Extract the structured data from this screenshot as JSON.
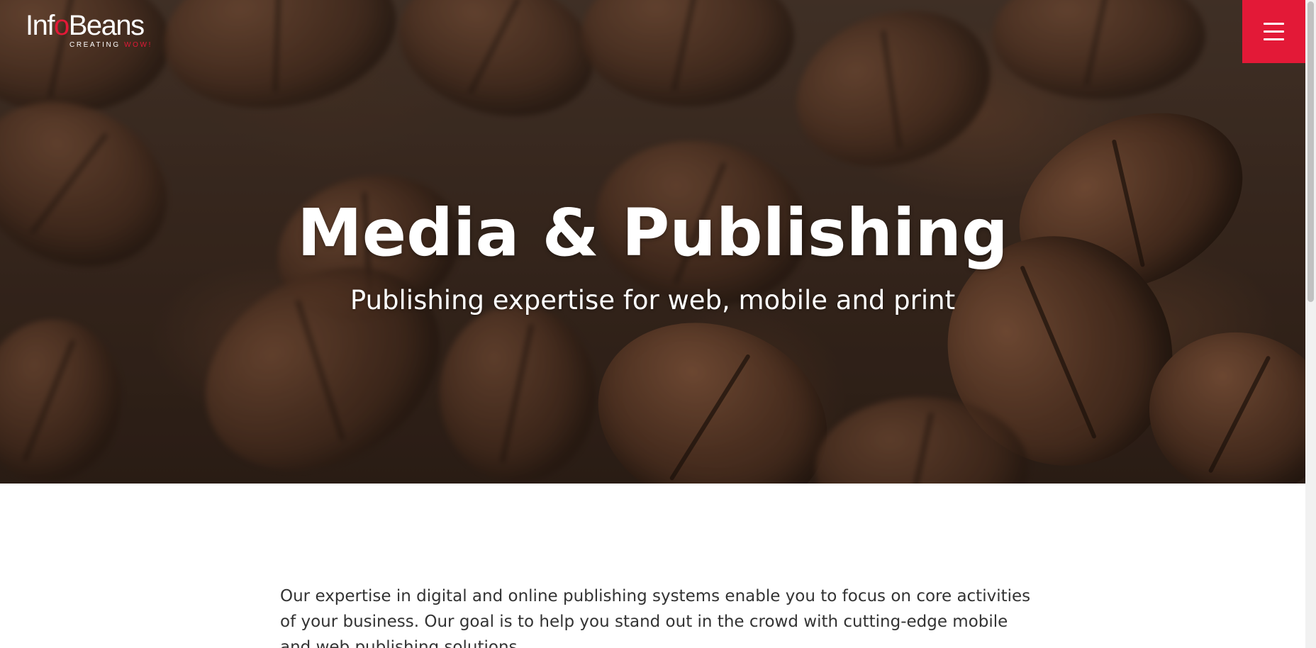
{
  "header": {
    "logo": {
      "name_part1": "Inf",
      "name_ring": "o",
      "name_part2": "Beans",
      "tagline_main": "CREATING ",
      "tagline_accent": "WOW!"
    },
    "menu_icon": "hamburger-icon"
  },
  "hero": {
    "title": "Media & Publishing",
    "subtitle": "Publishing expertise for web, mobile and print",
    "background": "coffee-beans-photo"
  },
  "main": {
    "intro": "Our expertise in digital and online publishing systems enable you to focus on core activities of your business. Our goal is to help you stand out in the crowd with cutting-edge mobile and web publishing solutions."
  },
  "colors": {
    "brand_red": "#e31937",
    "text_dark": "#333333",
    "hero_text": "#ffffff"
  }
}
